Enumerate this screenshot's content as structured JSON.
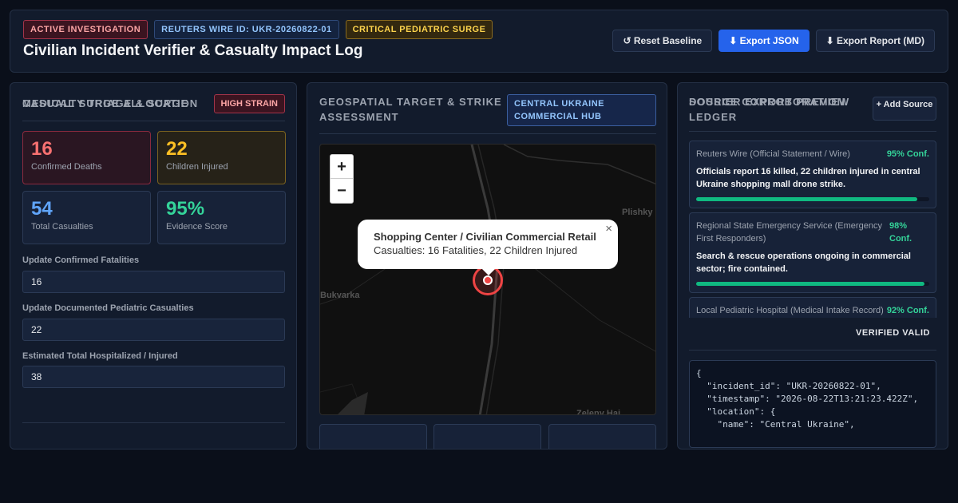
{
  "header": {
    "badges": [
      "ACTIVE INVESTIGATION",
      "REUTERS WIRE ID: UKR-20260822-01",
      "CRITICAL PEDIATRIC SURGE"
    ],
    "title": "Civilian Incident Verifier & Casualty Impact Log",
    "actions": {
      "reset": "↺ Reset Baseline",
      "export_json": "⬇ Export JSON",
      "export_report": "⬇ Export Report (MD)"
    }
  },
  "triage": {
    "title": "CASUALTY TRIAGE & SURGE",
    "strain_badge": "HIGH STRAIN",
    "stats": [
      {
        "value": "16",
        "label": "Confirmed Deaths"
      },
      {
        "value": "22",
        "label": "Children Injured"
      },
      {
        "value": "54",
        "label": "Total Casualties"
      },
      {
        "value": "95%",
        "label": "Evidence Score"
      }
    ],
    "fields": [
      {
        "label": "Update Confirmed Fatalities",
        "value": "16"
      },
      {
        "label": "Update Documented Pediatric Casualties",
        "value": "22"
      },
      {
        "label": "Estimated Total Hospitalized / Injured",
        "value": "38"
      }
    ],
    "surge_title": "MEDICAL SURGE ALLOCATION"
  },
  "geo": {
    "title": "GEOSPATIAL TARGET & STRIKE ASSESSMENT",
    "location_badge": "CENTRAL UKRAINE COMMERCIAL HUB",
    "zoom_in": "+",
    "zoom_out": "−",
    "popup": {
      "title": "Shopping Center / Civilian Commercial Retail",
      "subtitle": "Casualties: 16 Fatalities, 22 Children Injured",
      "close": "×"
    },
    "map_labels": [
      "Plishky",
      "Bukvarka",
      "Zeleny Hai"
    ]
  },
  "sources": {
    "title": "SOURCE CORROBORATION LEDGER",
    "add_button": "+ Add Source",
    "items": [
      {
        "source": "Reuters Wire (Official Statement / Wire)",
        "confidence": "95% Conf.",
        "statement": "Officials report 16 killed, 22 children injured in central Ukraine shopping mall drone strike.",
        "confidence_value": 0.95
      },
      {
        "source": "Regional State Emergency Service (Emergency First Responders)",
        "confidence": "98% Conf.",
        "statement": "Search & rescue operations ongoing in commercial sector; fire contained.",
        "confidence_value": 0.98
      },
      {
        "source": "Local Pediatric Hospital (Medical Intake Record)",
        "confidence": "92% Conf.",
        "statement": "",
        "confidence_value": 0.92
      }
    ],
    "dossier_title": "DOSSIER EXPORT PREVIEW",
    "dossier_status": "VERIFIED VALID",
    "dossier_json": "{\n  \"incident_id\": \"UKR-20260822-01\",\n  \"timestamp\": \"2026-08-22T13:21:23.422Z\",\n  \"location\": {\n    \"name\": \"Central Ukraine\","
  }
}
